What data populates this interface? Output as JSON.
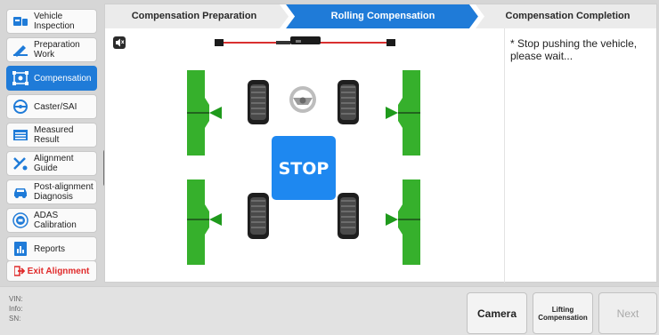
{
  "sidebar": {
    "items": [
      {
        "label": "Vehicle\nInspection",
        "icon": "vehicle-inspection-icon"
      },
      {
        "label": "Preparation\nWork",
        "icon": "preparation-icon"
      },
      {
        "label": "Compensation",
        "icon": "compensation-icon",
        "active": true
      },
      {
        "label": "Caster/SAI",
        "icon": "caster-icon"
      },
      {
        "label": "Measured\nResult",
        "icon": "measured-result-icon"
      },
      {
        "label": "Alignment\nGuide",
        "icon": "alignment-guide-icon"
      },
      {
        "label": "Post-alignment\nDiagnosis",
        "icon": "post-alignment-icon"
      },
      {
        "label": "ADAS\nCalibration",
        "icon": "adas-icon"
      },
      {
        "label": "Reports",
        "icon": "reports-icon"
      }
    ],
    "exit_label": "Exit Alignment"
  },
  "steps": [
    {
      "label": "Compensation Preparation",
      "active": false
    },
    {
      "label": "Rolling Compensation",
      "active": true
    },
    {
      "label": "Compensation Completion",
      "active": false
    }
  ],
  "message": "* Stop pushing the vehicle, please wait...",
  "stop_sign": "STOP",
  "info": {
    "vin": "VIN:",
    "info": "Info:",
    "sn": "SN:"
  },
  "buttons": {
    "camera": "Camera",
    "lifting": "Lifting\nCompensation",
    "next": "Next"
  },
  "colors": {
    "accent": "#1f7bd8",
    "stop": "#1e88f0",
    "target": "#2fae2a",
    "exit": "#e02a2a"
  }
}
